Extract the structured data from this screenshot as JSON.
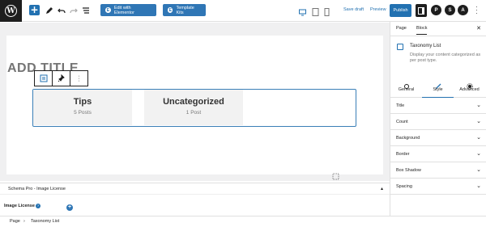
{
  "toolbar": {
    "add_symbol": "+",
    "elementor_label": "Edit with Elementor",
    "kits_label": "Template Kits",
    "save_draft_label": "Save draft",
    "preview_label": "Preview",
    "publish_label": "Publish",
    "plugin_icons": [
      "P",
      "S",
      "A"
    ]
  },
  "editor": {
    "title_placeholder": "ADD TITLE",
    "taxonomies": [
      {
        "name": "Tips",
        "count": "5 Posts"
      },
      {
        "name": "Uncategorized",
        "count": "1 Post"
      }
    ]
  },
  "metabox": {
    "title": "Schema Pro - Image License",
    "field_label": "Image License",
    "help": "?",
    "add_symbol": "+"
  },
  "breadcrumb": {
    "items": [
      "Page",
      "Taxonomy List"
    ],
    "separator": "›"
  },
  "sidebar": {
    "tabs": [
      "Page",
      "Block"
    ],
    "close_symbol": "✕",
    "block_title": "Taxonomy List",
    "block_description": "Display your content categorized as per post type.",
    "style_tabs": [
      "General",
      "Style",
      "Advanced"
    ],
    "panels": [
      "Title",
      "Count",
      "Background",
      "Border",
      "Box Shadow",
      "Spacing"
    ],
    "chevron": "⌄"
  },
  "colors": {
    "primary": "#2271b1",
    "elementor": "#2f76b5",
    "dark": "#1e1e1e"
  }
}
